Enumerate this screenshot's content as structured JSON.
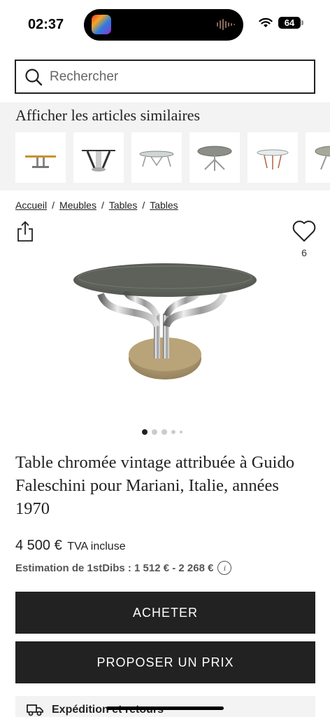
{
  "status_bar": {
    "time": "02:37",
    "battery": "64"
  },
  "search": {
    "placeholder": "Rechercher"
  },
  "similar": {
    "title": "Afficher les articles similaires"
  },
  "breadcrumb": [
    {
      "label": "Accueil"
    },
    {
      "label": "Meubles"
    },
    {
      "label": "Tables"
    },
    {
      "label": "Tables"
    }
  ],
  "breadcrumb_separator": "/",
  "favorite": {
    "count": "6"
  },
  "carousel": {
    "total": 5,
    "active": 1
  },
  "product": {
    "title": "Table chromée vintage attribuée à Guido Faleschini pour Mariani, Italie, années 1970",
    "price": "4 500 €",
    "vat": "TVA incluse",
    "estimate": "Estimation de 1stDibs : 1 512 € - 2 268 €"
  },
  "buttons": {
    "buy": "ACHETER",
    "offer": "PROPOSER UN PRIX"
  },
  "shipping": {
    "label": "Expédition et retours"
  },
  "colors": {
    "dark": "#222222",
    "panel": "#f3f3f3"
  }
}
